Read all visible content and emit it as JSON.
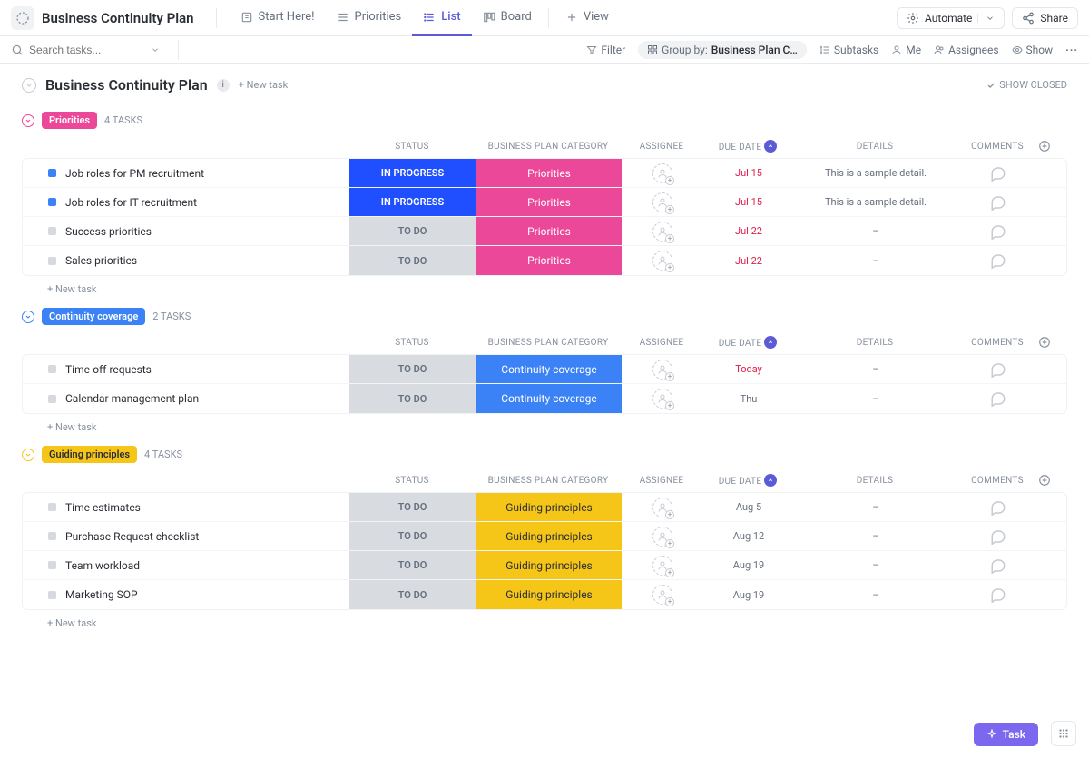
{
  "header": {
    "title": "Business Continuity Plan",
    "tabs": [
      "Start Here!",
      "Priorities",
      "List",
      "Board"
    ],
    "active_tab": 2,
    "view": "View",
    "automate": "Automate",
    "share": "Share"
  },
  "toolbar": {
    "search_placeholder": "Search tasks...",
    "filter": "Filter",
    "group_prefix": "Group by:",
    "group_value": "Business Plan C…",
    "subtasks": "Subtasks",
    "me": "Me",
    "assignees": "Assignees",
    "show": "Show"
  },
  "page": {
    "title": "Business Continuity Plan",
    "new_task": "+ New task",
    "show_closed": "SHOW CLOSED"
  },
  "columns": {
    "status": "STATUS",
    "category": "BUSINESS PLAN CATEGORY",
    "assignee": "ASSIGNEE",
    "due": "DUE DATE",
    "details": "DETAILS",
    "comments": "COMMENTS"
  },
  "groups": [
    {
      "label": "Priorities",
      "color": "#ec4899",
      "count": "4 TASKS",
      "cat_class": "cat-pink",
      "cat_text_dark": false,
      "tasks": [
        {
          "name": "Job roles for PM recruitment",
          "status": "IN PROGRESS",
          "status_class": "st-inprog",
          "sq": "blue",
          "cat": "Priorities",
          "due": "Jul 15",
          "due_class": "red",
          "det": "This is a sample detail."
        },
        {
          "name": "Job roles for IT recruitment",
          "status": "IN PROGRESS",
          "status_class": "st-inprog",
          "sq": "blue",
          "cat": "Priorities",
          "due": "Jul 15",
          "due_class": "red",
          "det": "This is a sample detail."
        },
        {
          "name": "Success priorities",
          "status": "TO DO",
          "status_class": "st-todo",
          "sq": "grey",
          "cat": "Priorities",
          "due": "Jul 22",
          "due_class": "red",
          "det": "–"
        },
        {
          "name": "Sales priorities",
          "status": "TO DO",
          "status_class": "st-todo",
          "sq": "grey",
          "cat": "Priorities",
          "due": "Jul 22",
          "due_class": "red",
          "det": "–"
        }
      ]
    },
    {
      "label": "Continuity coverage",
      "color": "#3b82f6",
      "count": "2 TASKS",
      "cat_class": "cat-blue",
      "cat_text_dark": false,
      "tasks": [
        {
          "name": "Time-off requests",
          "status": "TO DO",
          "status_class": "st-todo",
          "sq": "grey",
          "cat": "Continuity coverage",
          "due": "Today",
          "due_class": "red",
          "det": "–"
        },
        {
          "name": "Calendar management plan",
          "status": "TO DO",
          "status_class": "st-todo",
          "sq": "grey",
          "cat": "Continuity coverage",
          "due": "Thu",
          "due_class": "grey",
          "det": "–"
        }
      ]
    },
    {
      "label": "Guiding principles",
      "color": "#f5c518",
      "count": "4 TASKS",
      "cat_class": "cat-yellow",
      "cat_text_dark": true,
      "tasks": [
        {
          "name": "Time estimates",
          "status": "TO DO",
          "status_class": "st-todo",
          "sq": "grey",
          "cat": "Guiding principles",
          "due": "Aug 5",
          "due_class": "grey",
          "det": "–"
        },
        {
          "name": "Purchase Request checklist",
          "status": "TO DO",
          "status_class": "st-todo",
          "sq": "grey",
          "cat": "Guiding principles",
          "due": "Aug 12",
          "due_class": "grey",
          "det": "–"
        },
        {
          "name": "Team workload",
          "status": "TO DO",
          "status_class": "st-todo",
          "sq": "grey",
          "cat": "Guiding principles",
          "due": "Aug 19",
          "due_class": "grey",
          "det": "–"
        },
        {
          "name": "Marketing SOP",
          "status": "TO DO",
          "status_class": "st-todo",
          "sq": "grey",
          "cat": "Guiding principles",
          "due": "Aug 19",
          "due_class": "grey",
          "det": "–"
        }
      ]
    }
  ],
  "float": {
    "task": "Task"
  }
}
